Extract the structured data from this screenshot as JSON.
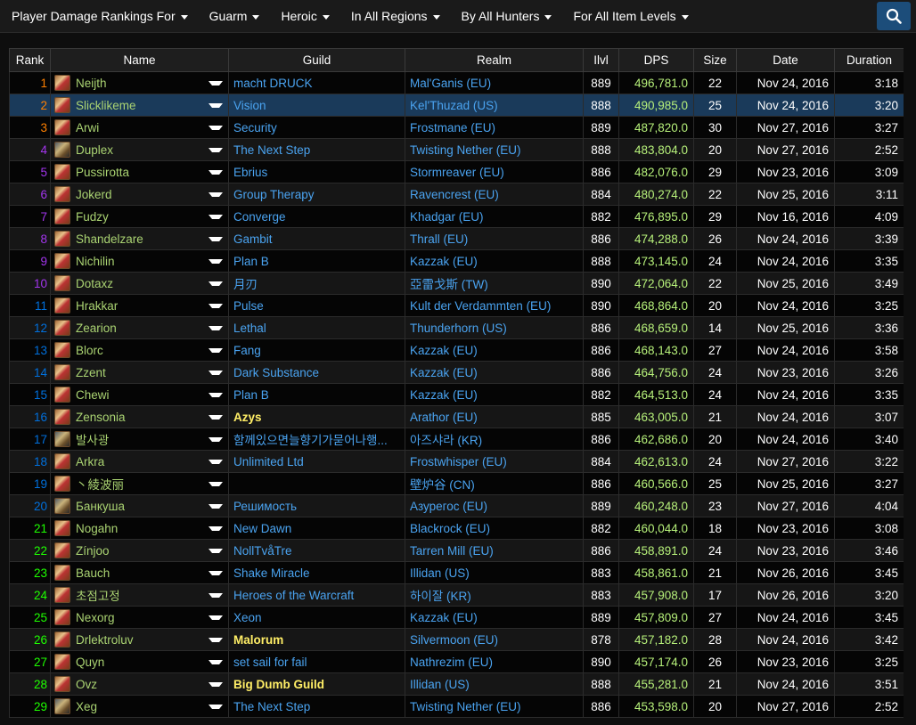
{
  "filters": [
    {
      "label": "Player Damage Rankings For"
    },
    {
      "label": "Guarm"
    },
    {
      "label": "Heroic"
    },
    {
      "label": "In All Regions"
    },
    {
      "label": "By All Hunters"
    },
    {
      "label": "For All Item Levels"
    }
  ],
  "columns": [
    "Rank",
    "Name",
    "Guild",
    "Realm",
    "Ilvl",
    "DPS",
    "Size",
    "Date",
    "Duration"
  ],
  "colors": {
    "dps": "#b6f07a",
    "link": "#4aa3f0",
    "hunter": "#aad372",
    "guild_highlight": "#ffee66"
  },
  "rows": [
    {
      "rank": "1",
      "rank_color": "#ff8000",
      "name": "Neijth",
      "icon": "spec-icon",
      "guild": "macht DRUCK",
      "realm": "Mal'Ganis (EU)",
      "ilvl": "889",
      "dps": "496,781.0",
      "size": "22",
      "date": "Nov 24, 2016",
      "duration": "3:18"
    },
    {
      "rank": "2",
      "rank_color": "#ff8000",
      "name": "Slicklikeme",
      "icon": "spec-icon",
      "guild": "Vision",
      "realm": "Kel'Thuzad (US)",
      "ilvl": "888",
      "dps": "490,985.0",
      "size": "25",
      "date": "Nov 24, 2016",
      "duration": "3:20",
      "selected": true
    },
    {
      "rank": "3",
      "rank_color": "#ff8000",
      "name": "Arwi",
      "icon": "spec-icon",
      "guild": "Security",
      "realm": "Frostmane (EU)",
      "ilvl": "889",
      "dps": "487,820.0",
      "size": "30",
      "date": "Nov 27, 2016",
      "duration": "3:27"
    },
    {
      "rank": "4",
      "rank_color": "#a335ee",
      "name": "Duplex",
      "icon": "spec-icon-alt",
      "guild": "The Next Step",
      "realm": "Twisting Nether (EU)",
      "ilvl": "888",
      "dps": "483,804.0",
      "size": "20",
      "date": "Nov 27, 2016",
      "duration": "2:52"
    },
    {
      "rank": "5",
      "rank_color": "#a335ee",
      "name": "Pussirotta",
      "icon": "spec-icon",
      "guild": "Ebrius",
      "realm": "Stormreaver (EU)",
      "ilvl": "886",
      "dps": "482,076.0",
      "size": "29",
      "date": "Nov 23, 2016",
      "duration": "3:09"
    },
    {
      "rank": "6",
      "rank_color": "#a335ee",
      "name": "Jokerd",
      "icon": "spec-icon",
      "guild": "Group Therapy",
      "realm": "Ravencrest (EU)",
      "ilvl": "884",
      "dps": "480,274.0",
      "size": "22",
      "date": "Nov 25, 2016",
      "duration": "3:11"
    },
    {
      "rank": "7",
      "rank_color": "#a335ee",
      "name": "Fudzy",
      "icon": "spec-icon",
      "guild": "Converge",
      "realm": "Khadgar (EU)",
      "ilvl": "882",
      "dps": "476,895.0",
      "size": "29",
      "date": "Nov 16, 2016",
      "duration": "4:09"
    },
    {
      "rank": "8",
      "rank_color": "#a335ee",
      "name": "Shandelzare",
      "icon": "spec-icon",
      "guild": "Gambit",
      "realm": "Thrall (EU)",
      "ilvl": "886",
      "dps": "474,288.0",
      "size": "26",
      "date": "Nov 24, 2016",
      "duration": "3:39"
    },
    {
      "rank": "9",
      "rank_color": "#a335ee",
      "name": "Nichilin",
      "icon": "spec-icon",
      "guild": "Plan B",
      "realm": "Kazzak (EU)",
      "ilvl": "888",
      "dps": "473,145.0",
      "size": "24",
      "date": "Nov 24, 2016",
      "duration": "3:35"
    },
    {
      "rank": "10",
      "rank_color": "#a335ee",
      "name": "Dotaxz",
      "icon": "spec-icon",
      "guild": "月刃",
      "realm": "亞雷戈斯 (TW)",
      "ilvl": "890",
      "dps": "472,064.0",
      "size": "22",
      "date": "Nov 25, 2016",
      "duration": "3:49"
    },
    {
      "rank": "11",
      "rank_color": "#0070dd",
      "name": "Hrakkar",
      "icon": "spec-icon",
      "guild": "Pulse",
      "realm": "Kult der Verdammten (EU)",
      "ilvl": "890",
      "dps": "468,864.0",
      "size": "20",
      "date": "Nov 24, 2016",
      "duration": "3:25"
    },
    {
      "rank": "12",
      "rank_color": "#0070dd",
      "name": "Zearion",
      "icon": "spec-icon",
      "guild": "Lethal",
      "realm": "Thunderhorn (US)",
      "ilvl": "886",
      "dps": "468,659.0",
      "size": "14",
      "date": "Nov 25, 2016",
      "duration": "3:36"
    },
    {
      "rank": "13",
      "rank_color": "#0070dd",
      "name": "Blorc",
      "icon": "spec-icon",
      "guild": "Fang",
      "realm": "Kazzak (EU)",
      "ilvl": "886",
      "dps": "468,143.0",
      "size": "27",
      "date": "Nov 24, 2016",
      "duration": "3:58"
    },
    {
      "rank": "14",
      "rank_color": "#0070dd",
      "name": "Zzent",
      "icon": "spec-icon",
      "guild": "Dark Substance",
      "realm": "Kazzak (EU)",
      "ilvl": "886",
      "dps": "464,756.0",
      "size": "24",
      "date": "Nov 23, 2016",
      "duration": "3:26"
    },
    {
      "rank": "15",
      "rank_color": "#0070dd",
      "name": "Chewi",
      "icon": "spec-icon",
      "guild": "Plan B",
      "realm": "Kazzak (EU)",
      "ilvl": "882",
      "dps": "464,513.0",
      "size": "24",
      "date": "Nov 24, 2016",
      "duration": "3:35"
    },
    {
      "rank": "16",
      "rank_color": "#0070dd",
      "name": "Zensonia",
      "icon": "spec-icon",
      "guild": "Azys",
      "guild_bold": true,
      "realm": "Arathor (EU)",
      "ilvl": "885",
      "dps": "463,005.0",
      "size": "21",
      "date": "Nov 24, 2016",
      "duration": "3:07"
    },
    {
      "rank": "17",
      "rank_color": "#0070dd",
      "name": "발사광",
      "icon": "spec-icon-alt",
      "guild": "함께있으면늘향기가묻어나행...",
      "realm": "아즈샤라 (KR)",
      "ilvl": "886",
      "dps": "462,686.0",
      "size": "20",
      "date": "Nov 24, 2016",
      "duration": "3:40"
    },
    {
      "rank": "18",
      "rank_color": "#0070dd",
      "name": "Arkra",
      "icon": "spec-icon",
      "guild": "Unlimited Ltd",
      "realm": "Frostwhisper (EU)",
      "ilvl": "884",
      "dps": "462,613.0",
      "size": "24",
      "date": "Nov 27, 2016",
      "duration": "3:22"
    },
    {
      "rank": "19",
      "rank_color": "#0070dd",
      "name": "丶綾波丽",
      "icon": "spec-icon",
      "guild": "",
      "realm": "壁炉谷 (CN)",
      "ilvl": "886",
      "dps": "460,566.0",
      "size": "25",
      "date": "Nov 25, 2016",
      "duration": "3:27"
    },
    {
      "rank": "20",
      "rank_color": "#0070dd",
      "name": "Банкуша",
      "icon": "spec-icon-alt",
      "guild": "Решимость",
      "realm": "Азурегос (EU)",
      "ilvl": "889",
      "dps": "460,248.0",
      "size": "23",
      "date": "Nov 27, 2016",
      "duration": "4:04"
    },
    {
      "rank": "21",
      "rank_color": "#1eff00",
      "name": "Nogahn",
      "icon": "spec-icon",
      "guild": "New Dawn",
      "realm": "Blackrock (EU)",
      "ilvl": "882",
      "dps": "460,044.0",
      "size": "18",
      "date": "Nov 23, 2016",
      "duration": "3:08"
    },
    {
      "rank": "22",
      "rank_color": "#1eff00",
      "name": "Zínjoo",
      "icon": "spec-icon",
      "guild": "NollTvåTre",
      "realm": "Tarren Mill (EU)",
      "ilvl": "886",
      "dps": "458,891.0",
      "size": "24",
      "date": "Nov 23, 2016",
      "duration": "3:46"
    },
    {
      "rank": "23",
      "rank_color": "#1eff00",
      "name": "Bauch",
      "icon": "spec-icon",
      "guild": "Shake Miracle",
      "realm": "Illidan (US)",
      "ilvl": "883",
      "dps": "458,861.0",
      "size": "21",
      "date": "Nov 26, 2016",
      "duration": "3:45"
    },
    {
      "rank": "24",
      "rank_color": "#1eff00",
      "name": "초점고정",
      "icon": "spec-icon",
      "guild": "Heroes of the Warcraft",
      "realm": "하이잘 (KR)",
      "ilvl": "883",
      "dps": "457,908.0",
      "size": "17",
      "date": "Nov 26, 2016",
      "duration": "3:20"
    },
    {
      "rank": "25",
      "rank_color": "#1eff00",
      "name": "Nexorg",
      "icon": "spec-icon",
      "guild": "Xeon",
      "realm": "Kazzak (EU)",
      "ilvl": "889",
      "dps": "457,809.0",
      "size": "27",
      "date": "Nov 24, 2016",
      "duration": "3:45"
    },
    {
      "rank": "26",
      "rank_color": "#1eff00",
      "name": "Drlektroluv",
      "icon": "spec-icon",
      "guild": "Malorum",
      "guild_bold": true,
      "realm": "Silvermoon (EU)",
      "ilvl": "878",
      "dps": "457,182.0",
      "size": "28",
      "date": "Nov 24, 2016",
      "duration": "3:42"
    },
    {
      "rank": "27",
      "rank_color": "#1eff00",
      "name": "Quyn",
      "icon": "spec-icon",
      "guild": "set sail for fail",
      "realm": "Nathrezim (EU)",
      "ilvl": "890",
      "dps": "457,174.0",
      "size": "26",
      "date": "Nov 23, 2016",
      "duration": "3:25"
    },
    {
      "rank": "28",
      "rank_color": "#1eff00",
      "name": "Ovz",
      "icon": "spec-icon",
      "guild": "Big Dumb Guild",
      "guild_bold": true,
      "realm": "Illidan (US)",
      "ilvl": "888",
      "dps": "455,281.0",
      "size": "21",
      "date": "Nov 24, 2016",
      "duration": "3:51"
    },
    {
      "rank": "29",
      "rank_color": "#1eff00",
      "name": "Xeg",
      "icon": "spec-icon-alt",
      "guild": "The Next Step",
      "realm": "Twisting Nether (EU)",
      "ilvl": "886",
      "dps": "453,598.0",
      "size": "20",
      "date": "Nov 27, 2016",
      "duration": "2:52"
    }
  ]
}
